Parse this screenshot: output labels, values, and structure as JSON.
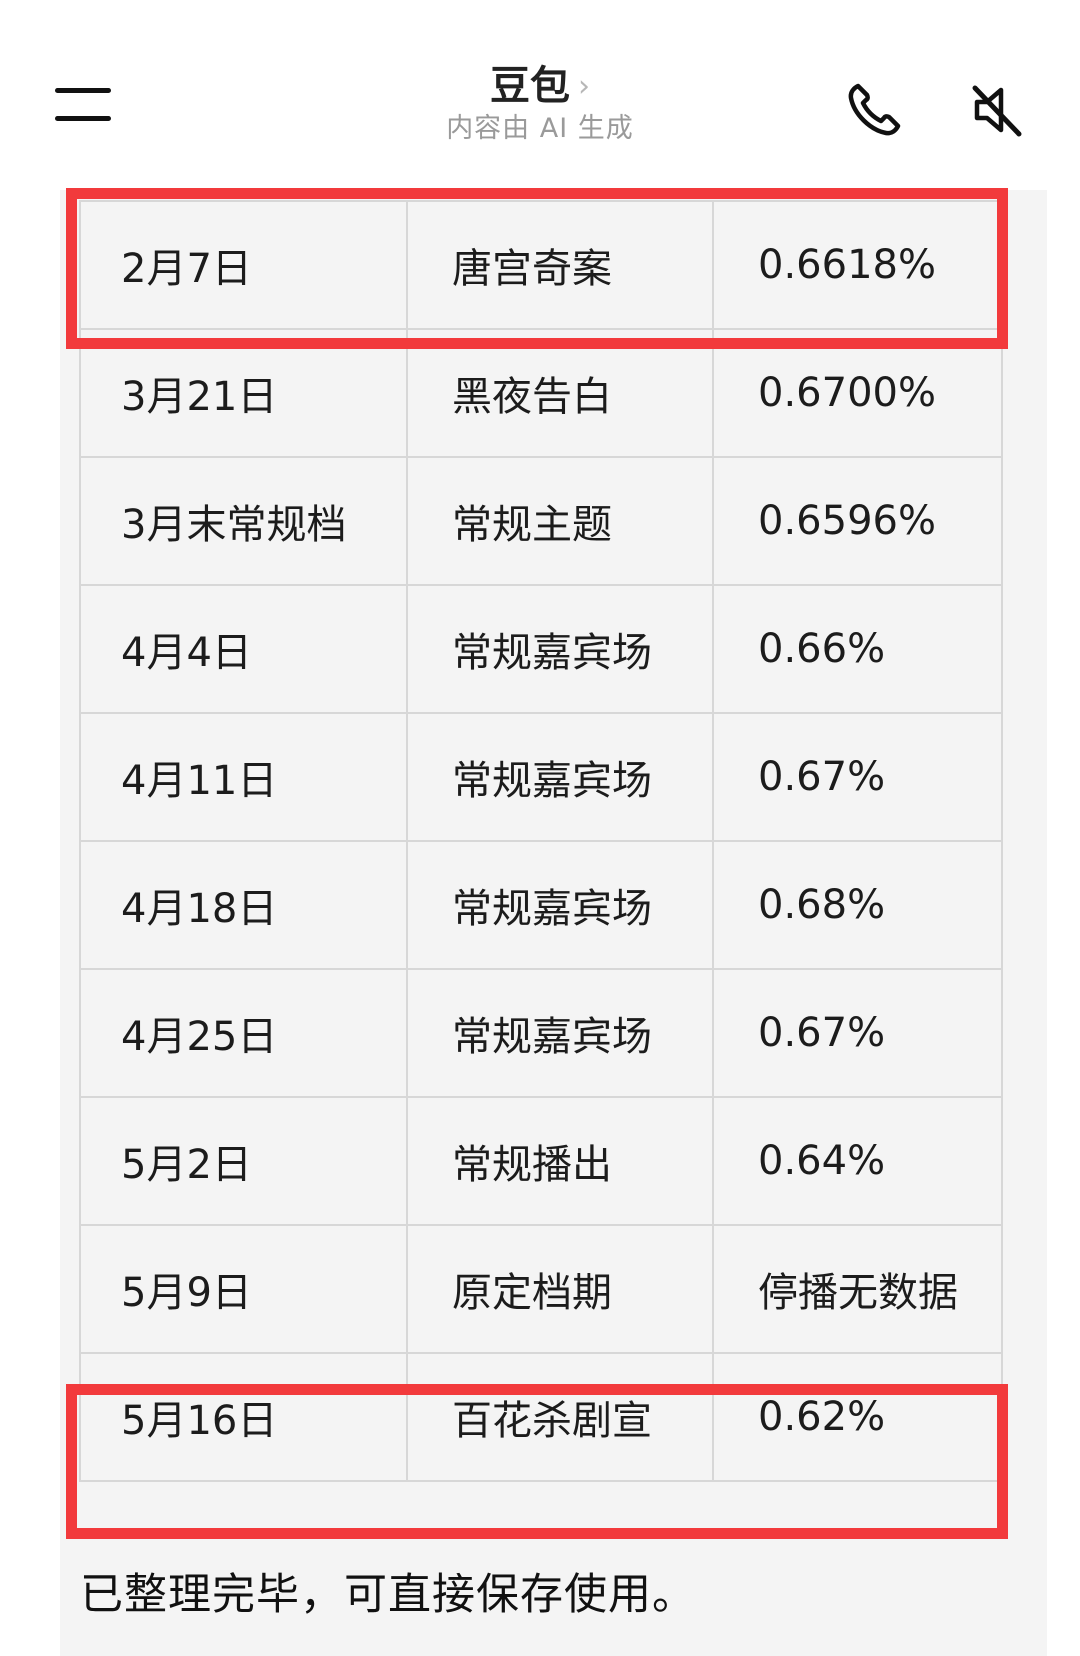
{
  "header": {
    "title": "豆包",
    "chevron": "›",
    "subtitle": "内容由 AI 生成",
    "menu_icon": "hamburger-menu-icon",
    "phone_icon": "phone-icon",
    "mute_icon": "speaker-muted-icon"
  },
  "table": {
    "rows": [
      {
        "date": "2月7日",
        "theme": "唐宫奇案",
        "rating": "0.6618%"
      },
      {
        "date": "3月21日",
        "theme": "黑夜告白",
        "rating": "0.6700%"
      },
      {
        "date": "3月末常规档",
        "theme": "常规主题",
        "rating": "0.6596%"
      },
      {
        "date": "4月4日",
        "theme": "常规嘉宾场",
        "rating": "0.66%"
      },
      {
        "date": "4月11日",
        "theme": "常规嘉宾场",
        "rating": "0.67%"
      },
      {
        "date": "4月18日",
        "theme": "常规嘉宾场",
        "rating": "0.68%"
      },
      {
        "date": "4月25日",
        "theme": "常规嘉宾场",
        "rating": "0.67%"
      },
      {
        "date": "5月2日",
        "theme": "常规播出",
        "rating": "0.64%"
      },
      {
        "date": "5月9日",
        "theme": "原定档期",
        "rating": "停播无数据"
      },
      {
        "date": "5月16日",
        "theme": "百花杀剧宣",
        "rating": "0.62%"
      }
    ],
    "highlight_color": "#f23a3c"
  },
  "footer": {
    "message": "已整理完毕，可直接保存使用。"
  }
}
